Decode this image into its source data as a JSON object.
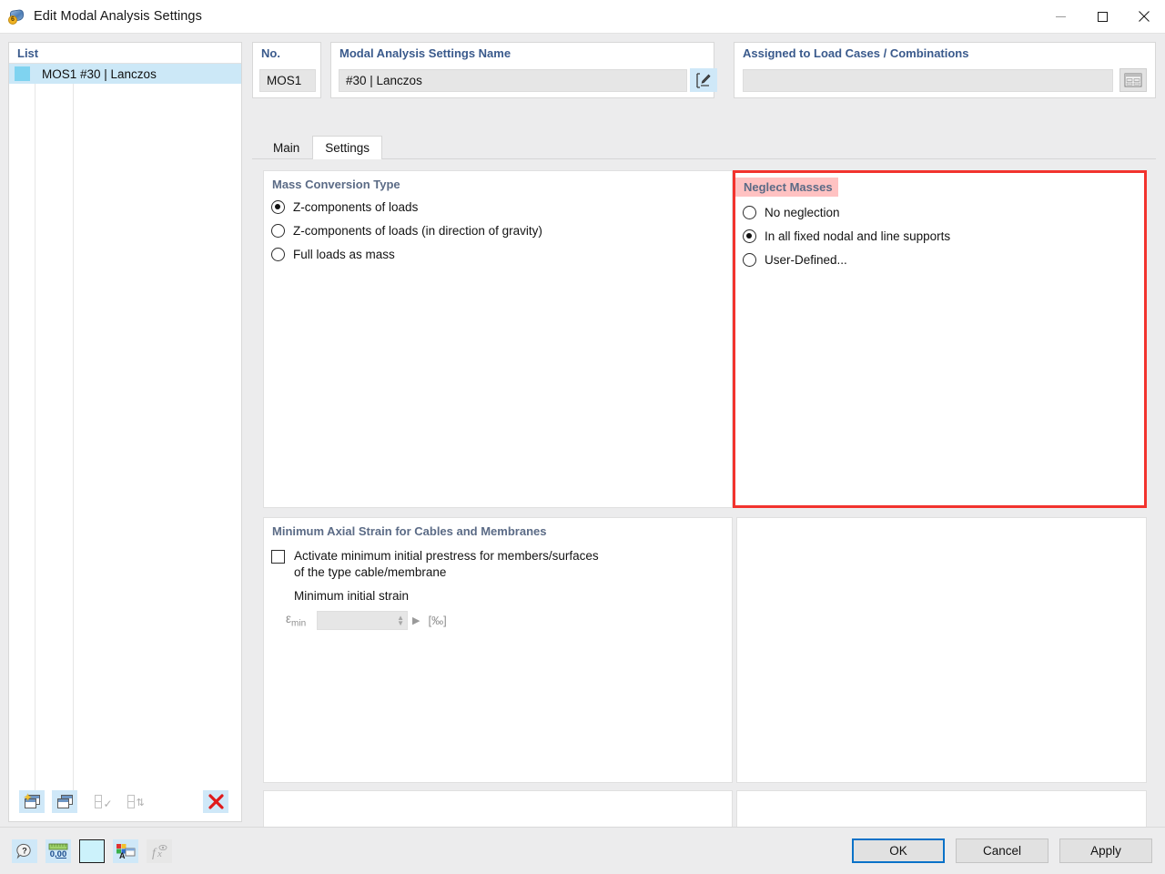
{
  "window": {
    "title": "Edit Modal Analysis Settings",
    "icon": "modal-analysis-icon",
    "minimize_label": "Minimize",
    "maximize_label": "Maximize",
    "close_label": "Close"
  },
  "list_panel": {
    "header": "List",
    "rows": [
      {
        "id": "MOS1",
        "name": "#30 | Lanczos",
        "selected": true
      }
    ],
    "toolbar": [
      {
        "name": "new-item-button",
        "label": "New"
      },
      {
        "name": "copy-item-button",
        "label": "Copy"
      },
      {
        "name": "select-all-button",
        "label": "Select All"
      },
      {
        "name": "invert-selection-button",
        "label": "Invert Selection"
      },
      {
        "name": "delete-item-button",
        "label": "Delete"
      }
    ]
  },
  "header": {
    "no_label": "No.",
    "no_value": "MOS1",
    "name_label": "Modal Analysis Settings Name",
    "name_value": "#30 | Lanczos",
    "name_edit_button": "edit-pencil-icon",
    "assigned_label": "Assigned to Load Cases / Combinations",
    "assigned_value": "",
    "assigned_button": "table-select-icon"
  },
  "tabs": [
    {
      "label": "Main",
      "active": false
    },
    {
      "label": "Settings",
      "active": true
    }
  ],
  "mass_conversion": {
    "title": "Mass Conversion Type",
    "options": [
      {
        "label": "Z-components of loads",
        "selected": true
      },
      {
        "label": "Z-components of loads (in direction of gravity)",
        "selected": false
      },
      {
        "label": "Full loads as mass",
        "selected": false
      }
    ]
  },
  "neglect_masses": {
    "title": "Neglect Masses",
    "highlighted": true,
    "highlight_color": "#ffc2c2",
    "border_color": "#f2332e",
    "options": [
      {
        "label": "No neglection",
        "selected": false
      },
      {
        "label": "In all fixed nodal and line supports",
        "selected": true
      },
      {
        "label": "User-Defined...",
        "selected": false
      }
    ]
  },
  "axial_strain": {
    "title": "Minimum Axial Strain for Cables and Membranes",
    "checkbox_label_line1": "Activate minimum initial prestress for members/surfaces",
    "checkbox_label_line2": "of the type cable/membrane",
    "checkbox_checked": false,
    "sub_label": "Minimum initial strain",
    "field_symbol": "εmin",
    "field_value": "",
    "field_unit": "[‰]",
    "field_enabled": false
  },
  "bottom_toolbar": [
    {
      "name": "help-button",
      "label": "Help"
    },
    {
      "name": "units-decimals-button",
      "label": "Units and Decimal Places"
    },
    {
      "name": "color-swatch-button",
      "label": "Color"
    },
    {
      "name": "display-properties-button",
      "label": "Display Properties"
    },
    {
      "name": "formula-button",
      "label": "Formula"
    }
  ],
  "dialog_buttons": {
    "ok": "OK",
    "cancel": "Cancel",
    "apply": "Apply"
  }
}
